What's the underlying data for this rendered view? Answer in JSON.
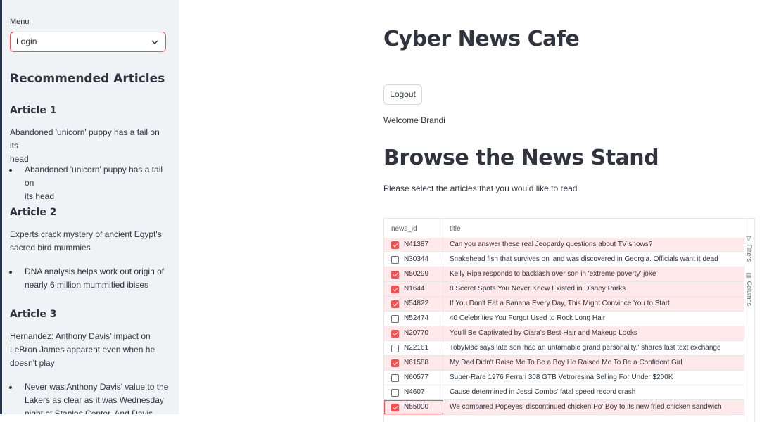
{
  "sidebar": {
    "menu_label": "Menu",
    "menu_selected": "Login",
    "recommended_heading": "Recommended Articles",
    "articles": [
      {
        "heading": "Article 1",
        "title_lines": [
          "Abandoned 'unicorn' puppy has a tail on its",
          "head"
        ],
        "abstract_lines": [
          "Abandoned 'unicorn' puppy has a tail on",
          "its head"
        ]
      },
      {
        "heading": "Article 2",
        "title_lines": [
          "Experts crack mystery of ancient Egypt's",
          "sacred bird mummies"
        ],
        "abstract_lines": [
          "DNA analysis helps work out origin of",
          "nearly 6 million mummified ibises"
        ]
      },
      {
        "heading": "Article 3",
        "title_lines": [
          "Hernandez: Anthony Davis' impact on",
          "LeBron James apparent even when he",
          "doesn't play"
        ],
        "abstract_lines": [
          "Never was Anthony Davis' value to the",
          "Lakers as clear as it was Wednesday",
          "night at Staples Center. And Davis didn't"
        ]
      }
    ]
  },
  "main": {
    "title": "Cyber News Cafe",
    "logout_label": "Logout",
    "welcome": "Welcome Brandi",
    "browse_title": "Browse the News Stand",
    "instruction": "Please select the articles that you would like to read"
  },
  "grid": {
    "col_id": "news_id",
    "col_title": "title",
    "side_filters": "Filters",
    "side_columns": "Columns",
    "rows": [
      {
        "id": "N41387",
        "title": "Can you answer these real Jeopardy questions about TV shows?",
        "selected": true
      },
      {
        "id": "N30344",
        "title": "Snakehead fish that survives on land was discovered in Georgia. Officials want it dead",
        "selected": false
      },
      {
        "id": "N50299",
        "title": "Kelly Ripa responds to backlash over son in 'extreme poverty' joke",
        "selected": true
      },
      {
        "id": "N1644",
        "title": "8 Secret Spots You Never Knew Existed in Disney Parks",
        "selected": true
      },
      {
        "id": "N54822",
        "title": "If You Don't Eat a Banana Every Day, This Might Convince You to Start",
        "selected": true
      },
      {
        "id": "N52474",
        "title": "40 Celebrities You Forgot Used to Rock Long Hair",
        "selected": false
      },
      {
        "id": "N20770",
        "title": "You'll Be Captivated by Ciara's Best Hair and Makeup Looks",
        "selected": true
      },
      {
        "id": "N22161",
        "title": "TobyMac says late son 'had an untamable grand personality,' shares last text exchange",
        "selected": false
      },
      {
        "id": "N61588",
        "title": "My Dad Didn't Raise Me To Be a Boy He Raised Me To Be a Confident Girl",
        "selected": true
      },
      {
        "id": "N60577",
        "title": "Super-Rare 1976 Ferrari 308 GTB Vetroresina Selling For Under $200K",
        "selected": false
      },
      {
        "id": "N4607",
        "title": "Cause determined in Jessi Combs' fatal speed record crash",
        "selected": false
      },
      {
        "id": "N55000",
        "title": "We compared Popeyes' discontinued chicken Po' Boy to its new fried chicken sandwich",
        "selected": true
      }
    ]
  },
  "colors": {
    "accent": "#ff4b4b",
    "selected_row": "#ffe9ea",
    "sidebar_bg": "#f0f2f6",
    "text": "#31333f"
  }
}
